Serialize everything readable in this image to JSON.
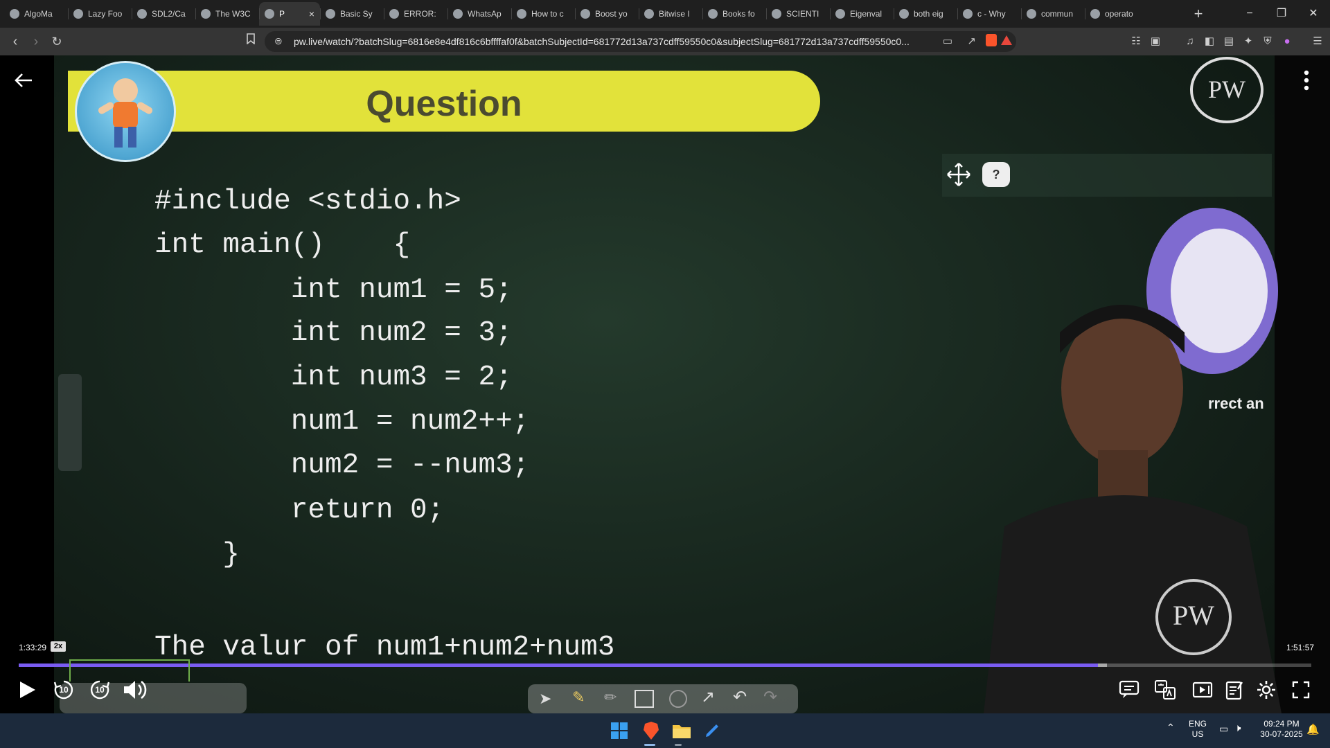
{
  "browser": {
    "tabs": [
      {
        "title": "AlgoMa",
        "icon": "algomap-icon"
      },
      {
        "title": "Lazy Foo",
        "icon": "lazyfoo-icon"
      },
      {
        "title": "SDL2/Ca",
        "icon": "sdl-icon"
      },
      {
        "title": "The W3C",
        "icon": "w3schools-icon"
      },
      {
        "title": "P",
        "icon": "pw-icon",
        "active": true
      },
      {
        "title": "Basic Sy",
        "icon": "doc-icon"
      },
      {
        "title": "ERROR:",
        "icon": "error-icon"
      },
      {
        "title": "WhatsAp",
        "icon": "whatsapp-icon"
      },
      {
        "title": "How to c",
        "icon": "edge-icon"
      },
      {
        "title": "Boost yo",
        "icon": "youtube-icon"
      },
      {
        "title": "Bitwise I",
        "icon": "bitwise-icon"
      },
      {
        "title": "Books fo",
        "icon": "google-icon"
      },
      {
        "title": "SCIENTI",
        "icon": "globe-icon"
      },
      {
        "title": "Eigenval",
        "icon": "globe-icon"
      },
      {
        "title": "both eig",
        "icon": "google-icon"
      },
      {
        "title": "c - Why",
        "icon": "stackoverflow-icon"
      },
      {
        "title": "commun",
        "icon": "google-icon"
      },
      {
        "title": "operato",
        "icon": "google-icon"
      }
    ],
    "new_tab": "+",
    "window_controls": [
      "−",
      "❐",
      "✕"
    ],
    "url": "pw.live/watch/?batchSlug=6816e8e4df816c6bffffaf0f&batchSubjectId=681772d13a737cdff59550c0&subjectSlug=681772d13a737cdff59550c0..."
  },
  "lecture": {
    "banner_title": "Question",
    "code_lines": [
      "#include <stdio.h>",
      "int main()    {",
      "        int num1 = 5;",
      "        int num2 = 3;",
      "        int num3 = 2;",
      "        num1 = num2++;",
      "        num2 = --num3;",
      "        return 0;",
      "    }",
      "The valur of num1+num2+num3"
    ],
    "logo_text": "PW",
    "corner_text": "rrect an",
    "help_badge": "?"
  },
  "player": {
    "time_elapsed": "1:33:29",
    "speed": "2x",
    "time_total": "1:51:57",
    "progress_fraction": 0.835,
    "buffer_fraction": 0.842,
    "skip_back_seconds": "10",
    "skip_forward_seconds": "10"
  },
  "taskbar": {
    "language_line1": "ENG",
    "language_line2": "US",
    "time": "09:24 PM",
    "date": "30-07-2025"
  },
  "colors": {
    "accent": "#7a5cf2",
    "banner": "#e2e23a",
    "board": "#1a2a20"
  }
}
